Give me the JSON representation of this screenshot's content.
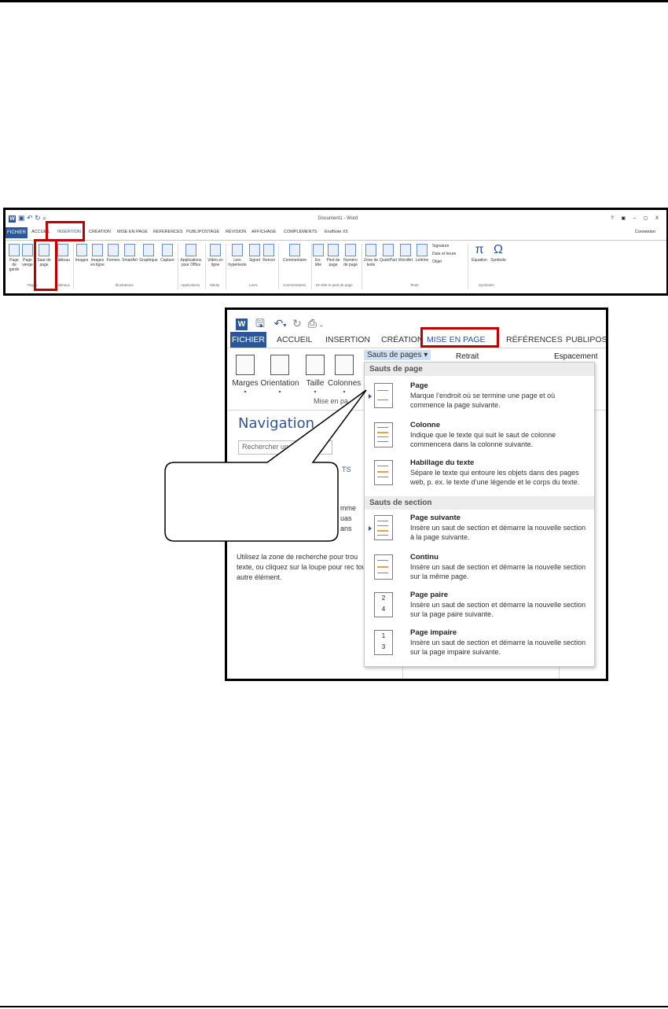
{
  "shot1": {
    "doc_title": "Document1 - Word",
    "window_controls": "? ▣ – ▢ X",
    "file_tab": "FICHIER",
    "tabs": [
      "ACCUEIL",
      "INSERTION",
      "CRÉATION",
      "MISE EN PAGE",
      "RÉFÉRENCES",
      "PUBLIPOSTAGE",
      "RÉVISION",
      "AFFICHAGE",
      "COMPLÉMENTS",
      "EndNote X5"
    ],
    "connexion": "Connexion",
    "buttons": [
      "Page de garde",
      "Page vierge",
      "Saut de page",
      "Tableau",
      "Images",
      "Images en ligne",
      "Formes",
      "SmartArt",
      "Graphique",
      "Capture",
      "Applications pour Office",
      "Vidéo en ligne",
      "Lien hypertexte",
      "Signet",
      "Renvoi",
      "Commentaire",
      "En-tête",
      "Pied de page",
      "Numéro de page",
      "Zone de texte",
      "QuickPart",
      "WordArt",
      "Lettrine",
      "Signature",
      "Date et heure",
      "Objet",
      "Équation",
      "Symbole"
    ],
    "groups": [
      "Pages",
      "Tableaux",
      "Illustrations",
      "Applications",
      "Média",
      "Liens",
      "Commentaires",
      "En-tête et pied de page",
      "Texte",
      "Symboles"
    ]
  },
  "shot2": {
    "file_tab": "FICHIER",
    "tabs": [
      "ACCUEIL",
      "INSERTION",
      "CRÉATION",
      "MISE EN PAGE",
      "RÉFÉRENCES",
      "PUBLIPOST"
    ],
    "ribbon_buttons": [
      "Marges",
      "Orientation",
      "Taille",
      "Colonnes"
    ],
    "group_label": "Mise en pa",
    "sauts_button": "Sauts de pages ▾",
    "retrait": "Retrait",
    "espacement": "Espacement",
    "nav_title": "Navigation",
    "search_placeholder": "Rechercher un",
    "nav_label": "TS",
    "nav_lines": [
      "mme",
      "uas",
      "ans"
    ],
    "nav_help": "Utilisez la zone de recherche pour trou texte, ou cliquez sur la loupe pour rec tout autre élément.",
    "menu": {
      "section_page": "Sauts de page",
      "section_section": "Sauts de section",
      "items": [
        {
          "title": "Page",
          "desc": "Marque l’endroit où se termine une page et où commence la page suivante."
        },
        {
          "title": "Colonne",
          "desc": "Indique que le texte qui suit le saut de colonne commencera dans la colonne suivante."
        },
        {
          "title": "Habillage du texte",
          "desc": "Sépare le texte qui entoure les objets dans des pages web, p. ex. le texte d’une légende et le corps du texte."
        },
        {
          "title": "Page suivante",
          "desc": "Insère un saut de section et démarre la nouvelle section à la page suivante."
        },
        {
          "title": "Continu",
          "desc": "Insère un saut de section et démarre la nouvelle section sur la même page."
        },
        {
          "title": "Page paire",
          "desc": "Insère un saut de section et démarre la nouvelle section sur la page paire suivante."
        },
        {
          "title": "Page impaire",
          "desc": "Insère un saut de section et démarre la nouvelle section sur la page impaire suivante."
        }
      ]
    }
  },
  "colors": {
    "accent": "#2b579a",
    "highlight": "#c00000"
  }
}
